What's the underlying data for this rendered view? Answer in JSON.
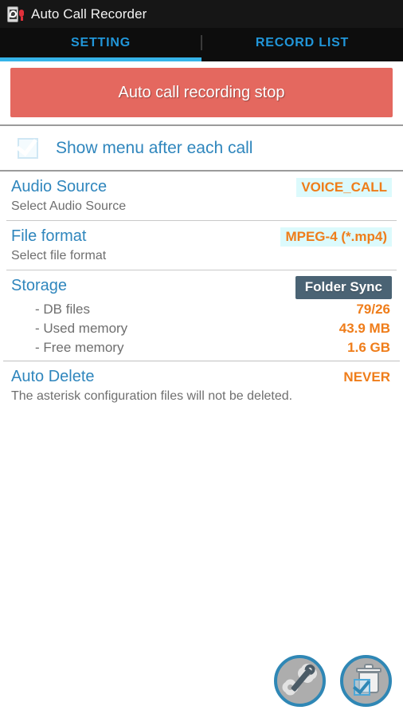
{
  "titlebar": {
    "app_name": "Auto Call Recorder",
    "icon": "phone-mic-icon"
  },
  "tabs": [
    {
      "label": "SETTING",
      "active": true
    },
    {
      "label": "RECORD LIST",
      "active": false
    }
  ],
  "primary_action": {
    "label": "Auto call recording stop",
    "color": "#e4685f"
  },
  "checkbox_pref": {
    "label": "Show menu after each call",
    "checked": true
  },
  "prefs": [
    {
      "title": "Audio Source",
      "subtitle": "Select Audio Source",
      "value": "VOICE_CALL",
      "highlight": true
    },
    {
      "title": "File format",
      "subtitle": "Select file format",
      "value": "MPEG-4 (*.mp4)",
      "highlight": true
    }
  ],
  "storage": {
    "title": "Storage",
    "button_label": "Folder Sync",
    "rows": [
      {
        "key": "- DB files",
        "value": "79/26"
      },
      {
        "key": "- Used memory",
        "value": "43.9 MB"
      },
      {
        "key": "- Free memory",
        "value": "1.6 GB"
      }
    ]
  },
  "auto_delete": {
    "title": "Auto Delete",
    "subtitle": "The asterisk configuration files will not be deleted.",
    "value": "NEVER",
    "highlight": false
  },
  "fabs": [
    {
      "icon": "tools-gear-wrench-icon",
      "name": "tools-button"
    },
    {
      "icon": "trash-check-icon",
      "name": "delete-button"
    }
  ],
  "colors": {
    "accent_blue": "#2f86bd",
    "tab_underline": "#35b3e8",
    "orange_value": "#ef7d1a",
    "value_highlight": "#dcfafc",
    "folder_sync_bg": "#4a6374",
    "stop_button": "#e4685f"
  }
}
